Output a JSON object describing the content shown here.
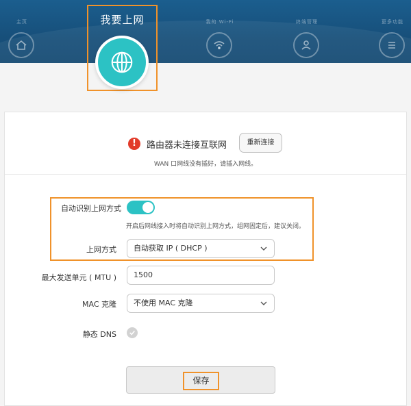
{
  "header": {
    "nav": [
      {
        "label": "主页",
        "icon": "home-icon"
      },
      {
        "label": "我要上网",
        "icon": "globe-icon",
        "active": true
      },
      {
        "label": "我的 Wi-Fi",
        "icon": "wifi-icon"
      },
      {
        "label": "终端管理",
        "icon": "user-icon"
      },
      {
        "label": "更多功能",
        "icon": "menu-icon"
      }
    ]
  },
  "status": {
    "message": "路由器未连接互联网",
    "reconnect_label": "重新连接",
    "sub_message": "WAN 口网线没有插好，请插入网线。"
  },
  "form": {
    "auto_detect": {
      "label": "自动识别上网方式",
      "enabled": true,
      "hint": "开启后网线接入时将自动识别上网方式，组网固定后，建议关闭。"
    },
    "connection_type": {
      "label": "上网方式",
      "value": "自动获取 IP ( DHCP )"
    },
    "mtu": {
      "label": "最大发送单元 ( MTU )",
      "value": "1500"
    },
    "mac_clone": {
      "label": "MAC 克隆",
      "value": "不使用 MAC 克隆"
    },
    "static_dns": {
      "label": "静态 DNS",
      "enabled": false
    },
    "save_label": "保存"
  },
  "colors": {
    "accent": "#2cc2c4",
    "header": "#174f7a",
    "highlight": "#f0922a",
    "warning": "#e23b2a"
  }
}
